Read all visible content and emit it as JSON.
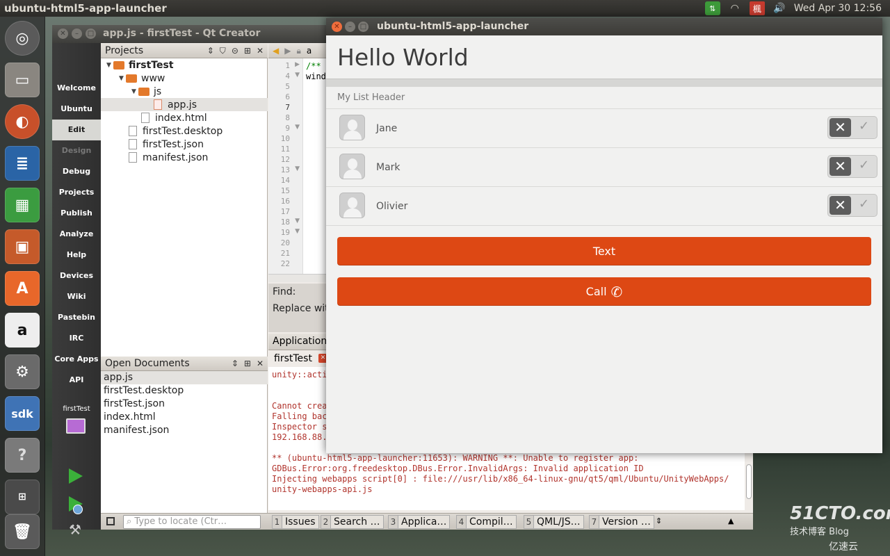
{
  "top_panel": {
    "app_title": "ubuntu-html5-app-launcher",
    "clock": "Wed Apr 30 12:56",
    "indicators": [
      "network-icon",
      "wifi-icon",
      "input-method-icon",
      "volume-icon"
    ]
  },
  "launcher": {
    "items": [
      "ubuntu-dash-icon",
      "files-icon",
      "firefox-icon",
      "writer-icon",
      "calc-icon",
      "impress-icon",
      "software-center-icon",
      "amazon-icon",
      "system-settings-icon",
      "ubuntu-sdk-icon",
      "help-icon",
      "workspace-switcher-icon",
      "trash-icon"
    ],
    "sdk_text": "sdk"
  },
  "qt_creator": {
    "title": "app.js - firstTest - Qt Creator",
    "modes": [
      "Welcome",
      "Ubuntu",
      "Edit",
      "Design",
      "Debug",
      "Projects",
      "Publish",
      "Analyze",
      "Help",
      "Devices",
      "Wiki",
      "Pastebin",
      "IRC",
      "Core Apps",
      "API"
    ],
    "active_mode": "Edit",
    "kit_label": "firstTest",
    "projects_pane": {
      "title": "Projects",
      "tree": [
        {
          "name": "firstTest",
          "type": "folder",
          "level": 0,
          "bold": true
        },
        {
          "name": "www",
          "type": "folder",
          "level": 1
        },
        {
          "name": "js",
          "type": "folder",
          "level": 2
        },
        {
          "name": "app.js",
          "type": "js",
          "level": 3,
          "selected": true
        },
        {
          "name": "index.html",
          "type": "file",
          "level": 2
        },
        {
          "name": "firstTest.desktop",
          "type": "file",
          "level": 1
        },
        {
          "name": "firstTest.json",
          "type": "file",
          "level": 1
        },
        {
          "name": "manifest.json",
          "type": "file",
          "level": 1
        }
      ]
    },
    "open_documents": {
      "title": "Open Documents",
      "items": [
        "app.js",
        "firstTest.desktop",
        "firstTest.json",
        "index.html",
        "manifest.json"
      ]
    },
    "editor": {
      "tab_fragment": "a",
      "line_numbers": [
        "1",
        "4",
        "5",
        "6",
        "7",
        "8",
        "9",
        "10",
        "11",
        "12",
        "13",
        "14",
        "15",
        "16",
        "17",
        "18",
        "19",
        "20",
        "21",
        "22"
      ],
      "code": [
        "/**",
        "wind"
      ]
    },
    "find": {
      "find_label": "Find:",
      "replace_label": "Replace wit"
    },
    "output": {
      "header": "Application",
      "tab": "firstTest",
      "lines": [
        "unity::acti",
        "",
        "",
        "Cannot crea",
        "Falling bac",
        "Inspector s",
        "192.168.88.",
        "",
        "** (ubuntu-html5-app-launcher:11653): WARNING **: Unable to register app:",
        "GDBus.Error:org.freedesktop.DBus.Error.InvalidArgs: Invalid application ID",
        "Injecting webapps script[0] : file:///usr/lib/x86_64-linux-gnu/qt5/qml/Ubuntu/UnityWebApps/",
        "unity-webapps-api.js"
      ]
    },
    "statusbar": {
      "locator_placeholder": "Type to locate (Ctr…",
      "panes": [
        {
          "num": "1",
          "label": "Issues"
        },
        {
          "num": "2",
          "label": "Search …"
        },
        {
          "num": "3",
          "label": "Applica…"
        },
        {
          "num": "4",
          "label": "Compil…"
        },
        {
          "num": "5",
          "label": "QML/JS…"
        },
        {
          "num": "7",
          "label": "Version …"
        }
      ]
    }
  },
  "web_app": {
    "window_title": "ubuntu-html5-app-launcher",
    "header": "Hello World",
    "list_header": "My List Header",
    "people": [
      {
        "name": "Jane",
        "switch_on": false
      },
      {
        "name": "Mark",
        "switch_on": false
      },
      {
        "name": "Olivier",
        "switch_on": false
      }
    ],
    "buttons": {
      "text_label": "Text",
      "call_label": "Call"
    },
    "accent_color": "#dd4814"
  },
  "watermark": {
    "site": "51CTO.com",
    "sub": "技术博客",
    "blog": "Blog",
    "brand": "亿速云"
  }
}
